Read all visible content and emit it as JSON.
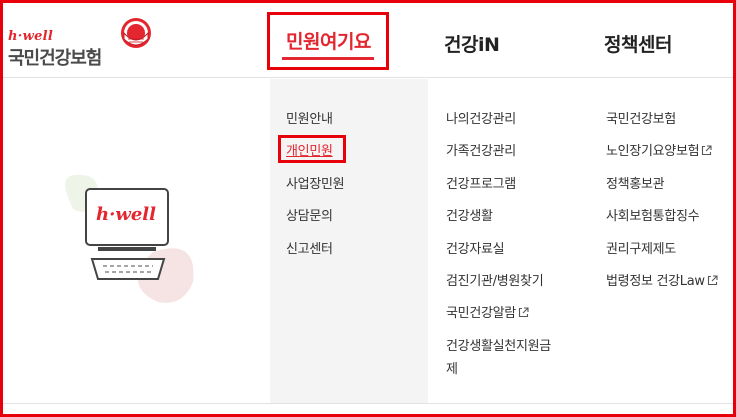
{
  "logo": {
    "en": "h·well",
    "ko": "국민건강보험"
  },
  "gnb": [
    {
      "label": "민원여기요"
    },
    {
      "label": "건강iN"
    },
    {
      "label": "정책센터"
    }
  ],
  "illustration": {
    "label": "h·well"
  },
  "menu_columns": [
    {
      "items": [
        "민원안내",
        "개인민원",
        "사업장민원",
        "상담문의",
        "신고센터"
      ]
    },
    {
      "items": [
        "나의건강관리",
        "가족건강관리",
        "건강프로그램",
        "건강생활",
        "건강자료실",
        "검진기관/병원찾기",
        "국민건강알람",
        "건강생활실천지원금",
        "제"
      ]
    },
    {
      "items": [
        "국민건강보험",
        "노인장기요양보험",
        "정책홍보관",
        "사회보험통합징수",
        "권리구제제도",
        "법령정보 건강Law"
      ]
    }
  ],
  "colors": {
    "accent": "#e3262f",
    "highlight_border": "#e8000b",
    "gray_column": "#f4f4f4"
  },
  "icons": {
    "external_link": "external-link-icon"
  }
}
